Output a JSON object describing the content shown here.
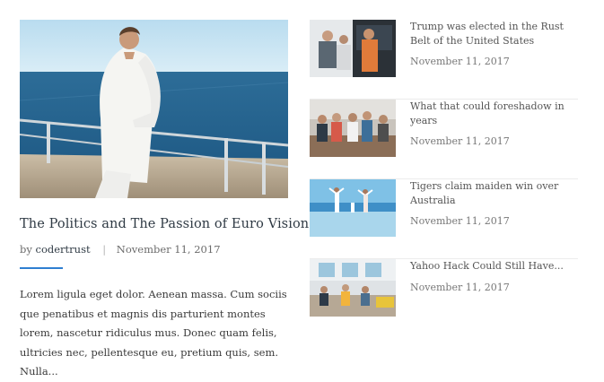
{
  "featured": {
    "title": "The Politics and The Passion of Euro Visions",
    "by_label": "by",
    "author": "codertrust",
    "separator": "|",
    "date": "November 11, 2017",
    "excerpt": "Lorem ligula eget dolor. Aenean massa. Cum sociis que penatibus et magnis dis parturient montes lorem, nascetur ridiculus mus. Donec quam felis, ultricies nec, pellentesque eu, pretium quis, sem. Nulla..."
  },
  "side_posts": [
    {
      "title": "Trump was elected in the Rust Belt of the United States",
      "date": "November 11, 2017"
    },
    {
      "title": "What that could foreshadow in years",
      "date": "November 11, 2017"
    },
    {
      "title": "Tigers claim maiden win over Australia",
      "date": "November 11, 2017"
    },
    {
      "title": "Yahoo Hack Could Still Have...",
      "date": "November 11, 2017"
    }
  ],
  "colors": {
    "accent": "#2f7fd1",
    "title": "#2f3a44",
    "text": "#3a3a3a"
  }
}
